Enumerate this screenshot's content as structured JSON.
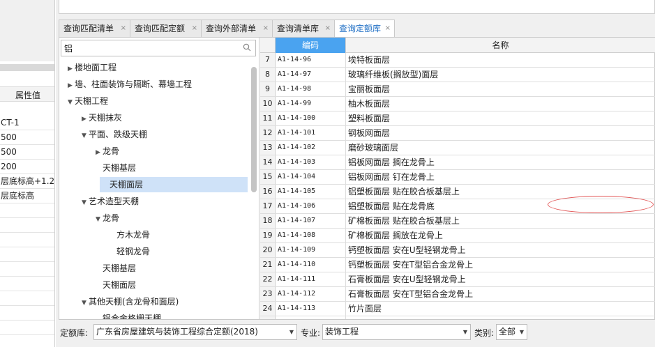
{
  "left_panel": {
    "column_header": "属性值",
    "values": [
      "CT-1",
      "500",
      "500",
      "200",
      "层底标高+1.2",
      "层底标高",
      "",
      "",
      "",
      "",
      "",
      "",
      "",
      "",
      ""
    ]
  },
  "tabs": [
    {
      "label": "查询匹配清单",
      "close": "×"
    },
    {
      "label": "查询匹配定额",
      "close": "×"
    },
    {
      "label": "查询外部清单",
      "close": "×"
    },
    {
      "label": "查询清单库",
      "close": "×"
    },
    {
      "label": "查询定额库",
      "close": "×"
    }
  ],
  "active_tab": 4,
  "search": {
    "value": "铝",
    "icon": "search-icon"
  },
  "tree": [
    {
      "label": "楼地面工程",
      "arrow": "▶",
      "level": 0
    },
    {
      "label": "墙、柱面装饰与隔断、幕墙工程",
      "arrow": "▶",
      "level": 0
    },
    {
      "label": "天棚工程",
      "arrow": "▼",
      "level": 0
    },
    {
      "label": "天棚抹灰",
      "arrow": "▶",
      "level": 1
    },
    {
      "label": "平面、跌级天棚",
      "arrow": "▼",
      "level": 1
    },
    {
      "label": "龙骨",
      "arrow": "▶",
      "level": 2
    },
    {
      "label": "天棚基层",
      "arrow": "",
      "level": 2
    },
    {
      "label": "天棚面层",
      "arrow": "",
      "level": 2,
      "selected": true
    },
    {
      "label": "艺术造型天棚",
      "arrow": "▼",
      "level": 1
    },
    {
      "label": "龙骨",
      "arrow": "▼",
      "level": 2
    },
    {
      "label": "方木龙骨",
      "arrow": "",
      "level": 3
    },
    {
      "label": "轻钢龙骨",
      "arrow": "",
      "level": 3
    },
    {
      "label": "天棚基层",
      "arrow": "",
      "level": 2
    },
    {
      "label": "天棚面层",
      "arrow": "",
      "level": 2
    },
    {
      "label": "其他天棚(含龙骨和面层)",
      "arrow": "▼",
      "level": 1
    },
    {
      "label": "铝合金格栅天棚",
      "arrow": "",
      "level": 2
    }
  ],
  "grid": {
    "header_code": "编码",
    "header_name": "名称",
    "rows": [
      {
        "idx": "7",
        "code": "A1-14-96",
        "name": "埃特板面层"
      },
      {
        "idx": "8",
        "code": "A1-14-97",
        "name": "玻璃纤维板(搁放型)面层"
      },
      {
        "idx": "9",
        "code": "A1-14-98",
        "name": "宝丽板面层"
      },
      {
        "idx": "10",
        "code": "A1-14-99",
        "name": "柚木板面层"
      },
      {
        "idx": "11",
        "code": "A1-14-100",
        "name": "塑料板面层"
      },
      {
        "idx": "12",
        "code": "A1-14-101",
        "name": "钢板网面层"
      },
      {
        "idx": "13",
        "code": "A1-14-102",
        "name": "磨砂玻璃面层"
      },
      {
        "idx": "14",
        "code": "A1-14-103",
        "name": "铝板网面层 搁在龙骨上"
      },
      {
        "idx": "15",
        "code": "A1-14-104",
        "name": "铝板网面层 钉在龙骨上"
      },
      {
        "idx": "16",
        "code": "A1-14-105",
        "name": "铝塑板面层 贴在胶合板基层上"
      },
      {
        "idx": "17",
        "code": "A1-14-106",
        "name": "铝塑板面层 贴在龙骨底"
      },
      {
        "idx": "18",
        "code": "A1-14-107",
        "name": "矿棉板面层 贴在胶合板基层上"
      },
      {
        "idx": "19",
        "code": "A1-14-108",
        "name": "矿棉板面层 搁放在龙骨上"
      },
      {
        "idx": "20",
        "code": "A1-14-109",
        "name": "钙塑板面层 安在U型轻钢龙骨上"
      },
      {
        "idx": "21",
        "code": "A1-14-110",
        "name": "钙塑板面层 安在T型铝合金龙骨上"
      },
      {
        "idx": "22",
        "code": "A1-14-111",
        "name": "石膏板面层 安在U型轻钢龙骨上"
      },
      {
        "idx": "23",
        "code": "A1-14-112",
        "name": "石膏板面层 安在T型铝合金龙骨上"
      },
      {
        "idx": "24",
        "code": "A1-14-113",
        "name": "竹片面层"
      },
      {
        "idx": "",
        "code": "",
        "name": ""
      }
    ]
  },
  "bottom": {
    "quota_label": "定额库:",
    "quota_value": "广东省房屋建筑与装饰工程综合定额(2018)",
    "major_label": "专业:",
    "major_value": "装饰工程",
    "category_label": "类别:",
    "category_value": "全部"
  }
}
